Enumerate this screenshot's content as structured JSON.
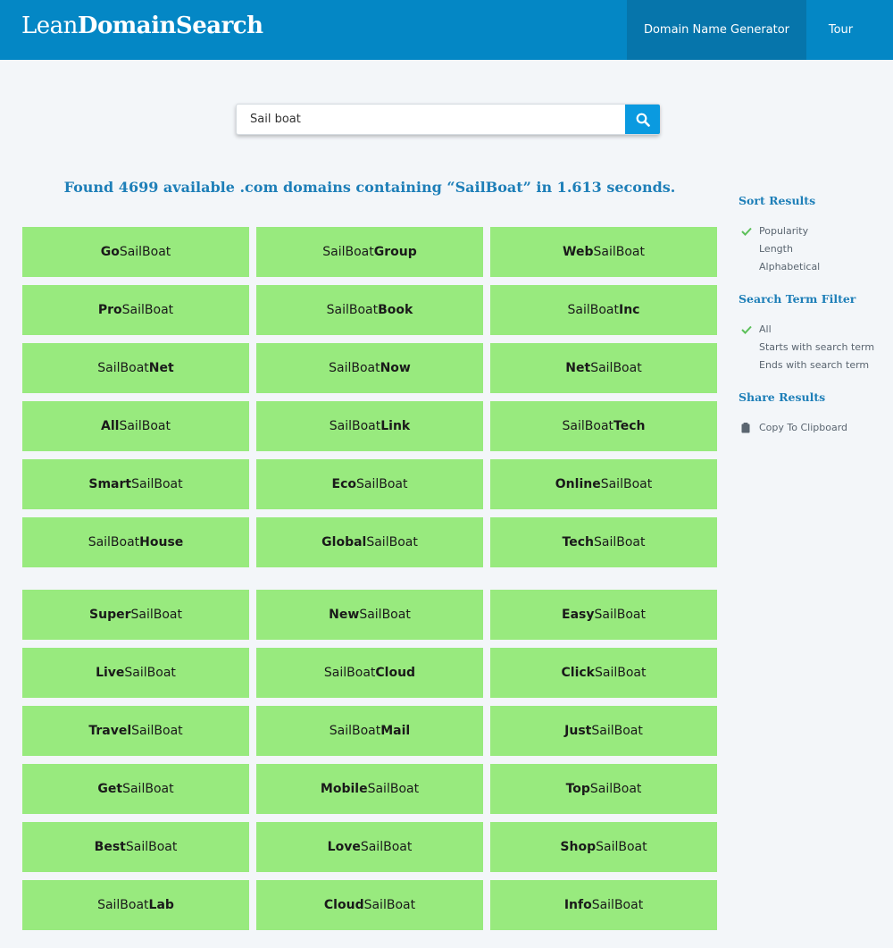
{
  "header": {
    "logo_light": "Lean",
    "logo_bold": "DomainSearch",
    "nav_generator": "Domain Name Generator",
    "nav_tour": "Tour"
  },
  "search": {
    "value": "Sail boat",
    "icon": "search-icon"
  },
  "results": {
    "summary": "Found 4699 available .com domains containing “SailBoat” in 1.613 seconds."
  },
  "sidebar": {
    "sort_heading": "Sort Results",
    "sort_options": [
      "Popularity",
      "Length",
      "Alphabetical"
    ],
    "sort_selected": "Popularity",
    "filter_heading": "Search Term Filter",
    "filter_options": [
      "All",
      "Starts with search term",
      "Ends with search term"
    ],
    "filter_selected": "All",
    "share_heading": "Share Results",
    "copy_label": "Copy To Clipboard",
    "check_color": "#5cc05a"
  },
  "colors": {
    "header_bg": "#0487c5",
    "nav_active_bg": "#0675ab",
    "tile_bg": "#98ea7e",
    "accent_text": "#1e7fb8"
  },
  "domains_group1": [
    {
      "pre": "Go",
      "base": "SailBoat",
      "suf": ""
    },
    {
      "pre": "",
      "base": "SailBoat",
      "suf": "Group"
    },
    {
      "pre": "Web",
      "base": "SailBoat",
      "suf": ""
    },
    {
      "pre": "Pro",
      "base": "SailBoat",
      "suf": ""
    },
    {
      "pre": "",
      "base": "SailBoat",
      "suf": "Book"
    },
    {
      "pre": "",
      "base": "SailBoat",
      "suf": "Inc"
    },
    {
      "pre": "",
      "base": "SailBoat",
      "suf": "Net"
    },
    {
      "pre": "",
      "base": "SailBoat",
      "suf": "Now"
    },
    {
      "pre": "Net",
      "base": "SailBoat",
      "suf": ""
    },
    {
      "pre": "All",
      "base": "SailBoat",
      "suf": ""
    },
    {
      "pre": "",
      "base": "SailBoat",
      "suf": "Link"
    },
    {
      "pre": "",
      "base": "SailBoat",
      "suf": "Tech"
    },
    {
      "pre": "Smart",
      "base": "SailBoat",
      "suf": ""
    },
    {
      "pre": "Eco",
      "base": "SailBoat",
      "suf": ""
    },
    {
      "pre": "Online",
      "base": "SailBoat",
      "suf": ""
    },
    {
      "pre": "",
      "base": "SailBoat",
      "suf": "House"
    },
    {
      "pre": "Global",
      "base": "SailBoat",
      "suf": ""
    },
    {
      "pre": "Tech",
      "base": "SailBoat",
      "suf": ""
    }
  ],
  "domains_group2": [
    {
      "pre": "Super",
      "base": "SailBoat",
      "suf": ""
    },
    {
      "pre": "New",
      "base": "SailBoat",
      "suf": ""
    },
    {
      "pre": "Easy",
      "base": "SailBoat",
      "suf": ""
    },
    {
      "pre": "Live",
      "base": "SailBoat",
      "suf": ""
    },
    {
      "pre": "",
      "base": "SailBoat",
      "suf": "Cloud"
    },
    {
      "pre": "Click",
      "base": "SailBoat",
      "suf": ""
    },
    {
      "pre": "Travel",
      "base": "SailBoat",
      "suf": ""
    },
    {
      "pre": "",
      "base": "SailBoat",
      "suf": "Mail"
    },
    {
      "pre": "Just",
      "base": "SailBoat",
      "suf": ""
    },
    {
      "pre": "Get",
      "base": "SailBoat",
      "suf": ""
    },
    {
      "pre": "Mobile",
      "base": "SailBoat",
      "suf": ""
    },
    {
      "pre": "Top",
      "base": "SailBoat",
      "suf": ""
    },
    {
      "pre": "Best",
      "base": "SailBoat",
      "suf": ""
    },
    {
      "pre": "Love",
      "base": "SailBoat",
      "suf": ""
    },
    {
      "pre": "Shop",
      "base": "SailBoat",
      "suf": ""
    },
    {
      "pre": "",
      "base": "SailBoat",
      "suf": "Lab"
    },
    {
      "pre": "Cloud",
      "base": "SailBoat",
      "suf": ""
    },
    {
      "pre": "Info",
      "base": "SailBoat",
      "suf": ""
    }
  ]
}
